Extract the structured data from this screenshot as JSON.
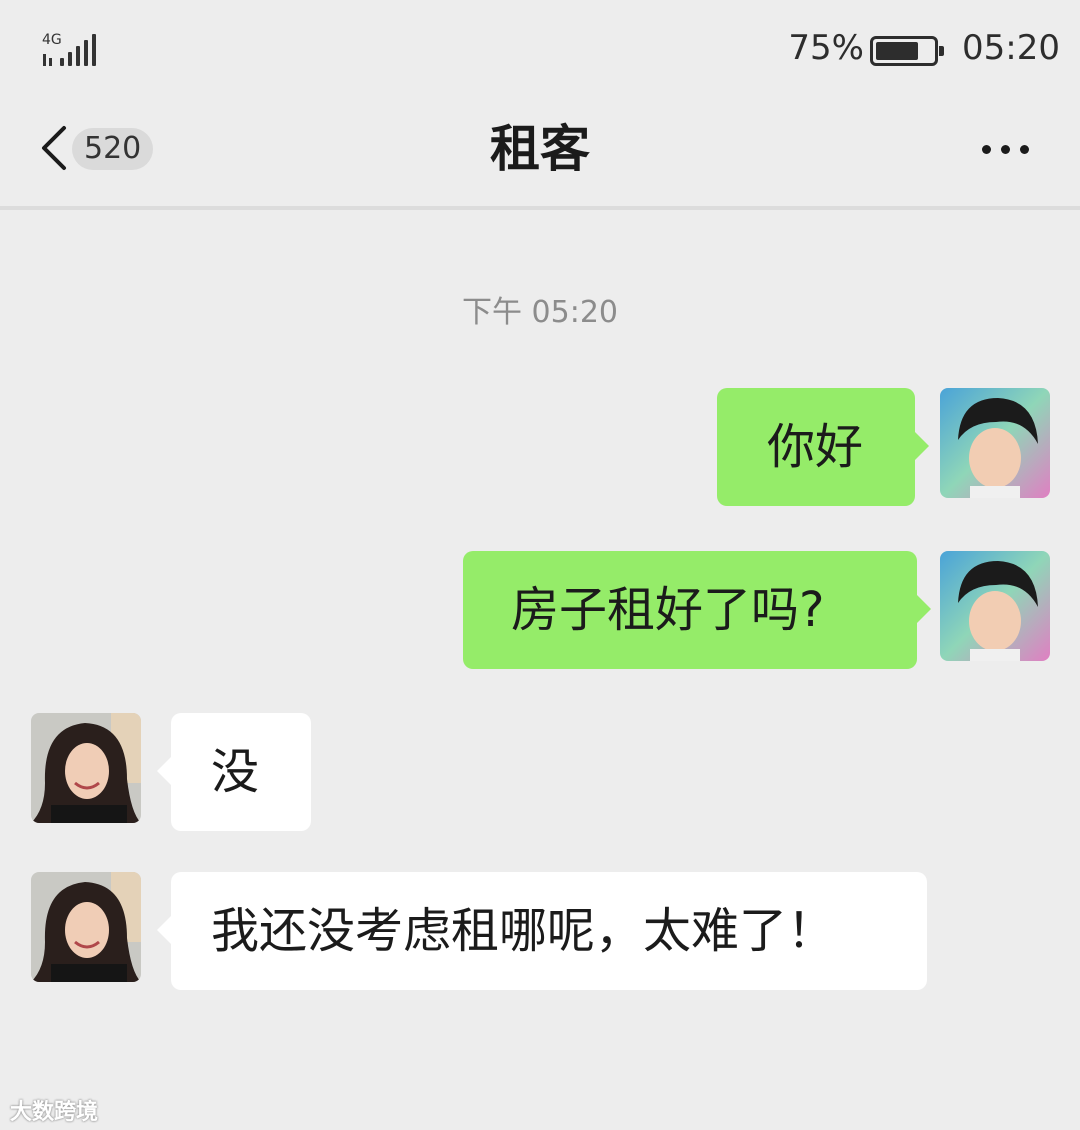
{
  "status_bar": {
    "network": "4G",
    "battery_percent": "75%",
    "battery_level": 0.75,
    "time": "05:20"
  },
  "nav": {
    "unread_count": "520",
    "title": "租客",
    "back_icon": "chevron-left-icon",
    "more_icon": "more-dots-icon"
  },
  "chat": {
    "timestamp": "下午 05:20",
    "messages": [
      {
        "side": "out",
        "text": "你好"
      },
      {
        "side": "out",
        "text": "房子租好了吗?"
      },
      {
        "side": "in",
        "text": "没"
      },
      {
        "side": "in",
        "text": "我还没考虑租哪呢，太难了！"
      }
    ]
  },
  "colors": {
    "background": "#ededed",
    "outgoing_bubble": "#95ec69",
    "incoming_bubble": "#ffffff"
  },
  "watermark": "大数跨境"
}
